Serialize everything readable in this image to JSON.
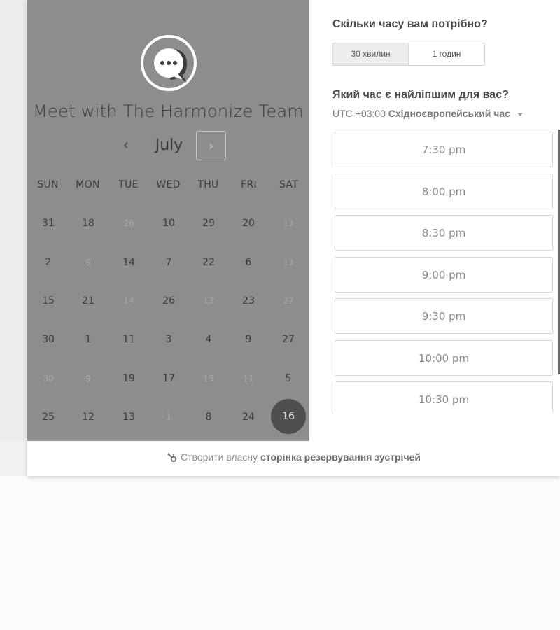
{
  "calendar": {
    "title": "Meet with The Harmonize Team",
    "month": "July",
    "prev_icon": "‹",
    "next_icon": "›",
    "weekdays": [
      "SUN",
      "MON",
      "TUE",
      "WED",
      "THU",
      "FRI",
      "SAT"
    ],
    "days": [
      [
        "31",
        "18",
        "26",
        "10",
        "29",
        "20",
        "13"
      ],
      [
        "2",
        "9",
        "14",
        "7",
        "22",
        "6",
        "13"
      ],
      [
        "15",
        "21",
        "14",
        "26",
        "13",
        "23",
        "27"
      ],
      [
        "30",
        "1",
        "11",
        "3",
        "4",
        "9",
        "27"
      ],
      [
        "30",
        "9",
        "19",
        "17",
        "15",
        "11",
        "5"
      ],
      [
        "25",
        "12",
        "13",
        "1",
        "8",
        "24",
        "16"
      ]
    ],
    "selected_day": "16"
  },
  "duration": {
    "question": "Скільки часу вам потрібно?",
    "options": [
      "30 хвилин",
      "1 годин"
    ],
    "selected": "30 хвилин"
  },
  "time": {
    "question": "Який час є найліпшим для вас?",
    "tz_offset": "UTC +03:00",
    "tz_name": "Східноєвропейський час",
    "slots": [
      "7:30 pm",
      "8:00 pm",
      "8:30 pm",
      "9:00 pm",
      "9:30 pm",
      "10:00 pm",
      "10:30 pm"
    ]
  },
  "footer": {
    "prefix": "Створити власну",
    "link": "сторінка резервування зустрічей"
  },
  "colors": {
    "panel": "#8d8d8d",
    "selected_day": "#4e4e4e"
  },
  "icons": {
    "logo": "chat-bubble-icon",
    "footer": "sprocket-icon"
  }
}
